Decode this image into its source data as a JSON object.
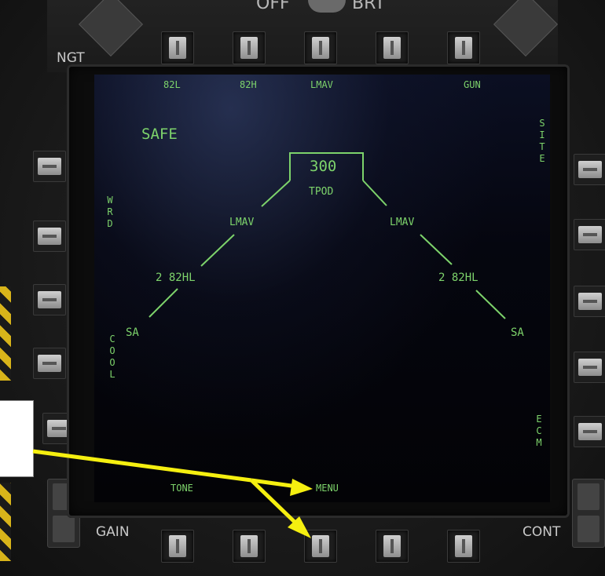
{
  "bezel": {
    "top_left_label": "NGT",
    "knob_left_label": "OFF",
    "knob_right_label": "BRT",
    "bottom_left_label": "GAIN",
    "bottom_right_label": "CONT"
  },
  "mfd": {
    "top_labels": [
      "82L",
      "82H",
      "LMAV",
      "GUN"
    ],
    "bottom_labels": {
      "left": "TONE",
      "center": "MENU"
    },
    "left_vertical": {
      "upper": "WRD",
      "lower": "COOL"
    },
    "right_vertical": {
      "upper": "SITE",
      "lower": "ECM"
    },
    "master_arm": "SAFE",
    "stations": {
      "center_value": "300",
      "center_label": "TPOD",
      "left_inner": "LMAV",
      "right_inner": "LMAV",
      "left_mid": "2 82HL",
      "right_mid": "2 82HL",
      "left_outer": "SA",
      "right_outer": "SA"
    }
  },
  "colors": {
    "mfd_green": "#7dd36b",
    "annotation_arrow": "#f5ef10",
    "hazard_yellow": "#d8b41a"
  }
}
